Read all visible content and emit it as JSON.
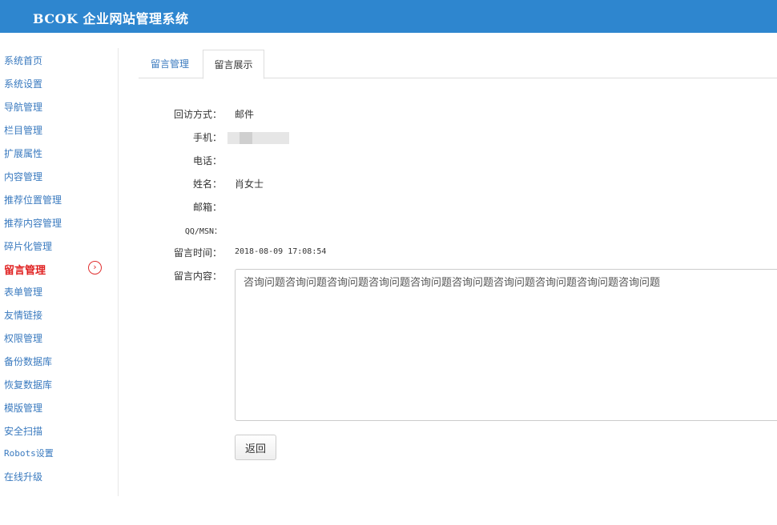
{
  "header": {
    "title": "BCOK 企业网站管理系统"
  },
  "sidebar": {
    "items": [
      {
        "label": "系统首页"
      },
      {
        "label": "系统设置"
      },
      {
        "label": "导航管理"
      },
      {
        "label": "栏目管理"
      },
      {
        "label": "扩展属性"
      },
      {
        "label": "内容管理"
      },
      {
        "label": "推荐位置管理"
      },
      {
        "label": "推荐内容管理"
      },
      {
        "label": "碎片化管理"
      },
      {
        "label": "留言管理",
        "active": true
      },
      {
        "label": "表单管理"
      },
      {
        "label": "友情链接"
      },
      {
        "label": "权限管理"
      },
      {
        "label": "备份数据库"
      },
      {
        "label": "恢复数据库"
      },
      {
        "label": "模版管理"
      },
      {
        "label": "安全扫描"
      },
      {
        "label": "Robots设置"
      },
      {
        "label": "在线升级"
      }
    ],
    "active_arrow_icon": "chevron-right-circle-icon"
  },
  "tabs": [
    {
      "label": "留言管理"
    },
    {
      "label": "留言展示",
      "active": true
    }
  ],
  "form": {
    "callback_method": {
      "label": "回访方式：",
      "value": "邮件"
    },
    "mobile": {
      "label": "手机：",
      "value": ""
    },
    "phone": {
      "label": "电话：",
      "value": ""
    },
    "name": {
      "label": "姓名：",
      "value": "肖女士"
    },
    "email": {
      "label": "邮箱：",
      "value": ""
    },
    "qq_msn": {
      "label": "QQ/MSN：",
      "value": ""
    },
    "time": {
      "label": "留言时间：",
      "value": "2018-08-09 17:08:54"
    },
    "content": {
      "label": "留言内容：",
      "value": "咨询问题咨询问题咨询问题咨询问题咨询问题咨询问题咨询问题咨询问题咨询问题咨询问题"
    }
  },
  "actions": {
    "back_label": "返回"
  },
  "colors": {
    "header_bg": "#2e86cf",
    "link": "#3a7abf",
    "active": "#e02020"
  }
}
